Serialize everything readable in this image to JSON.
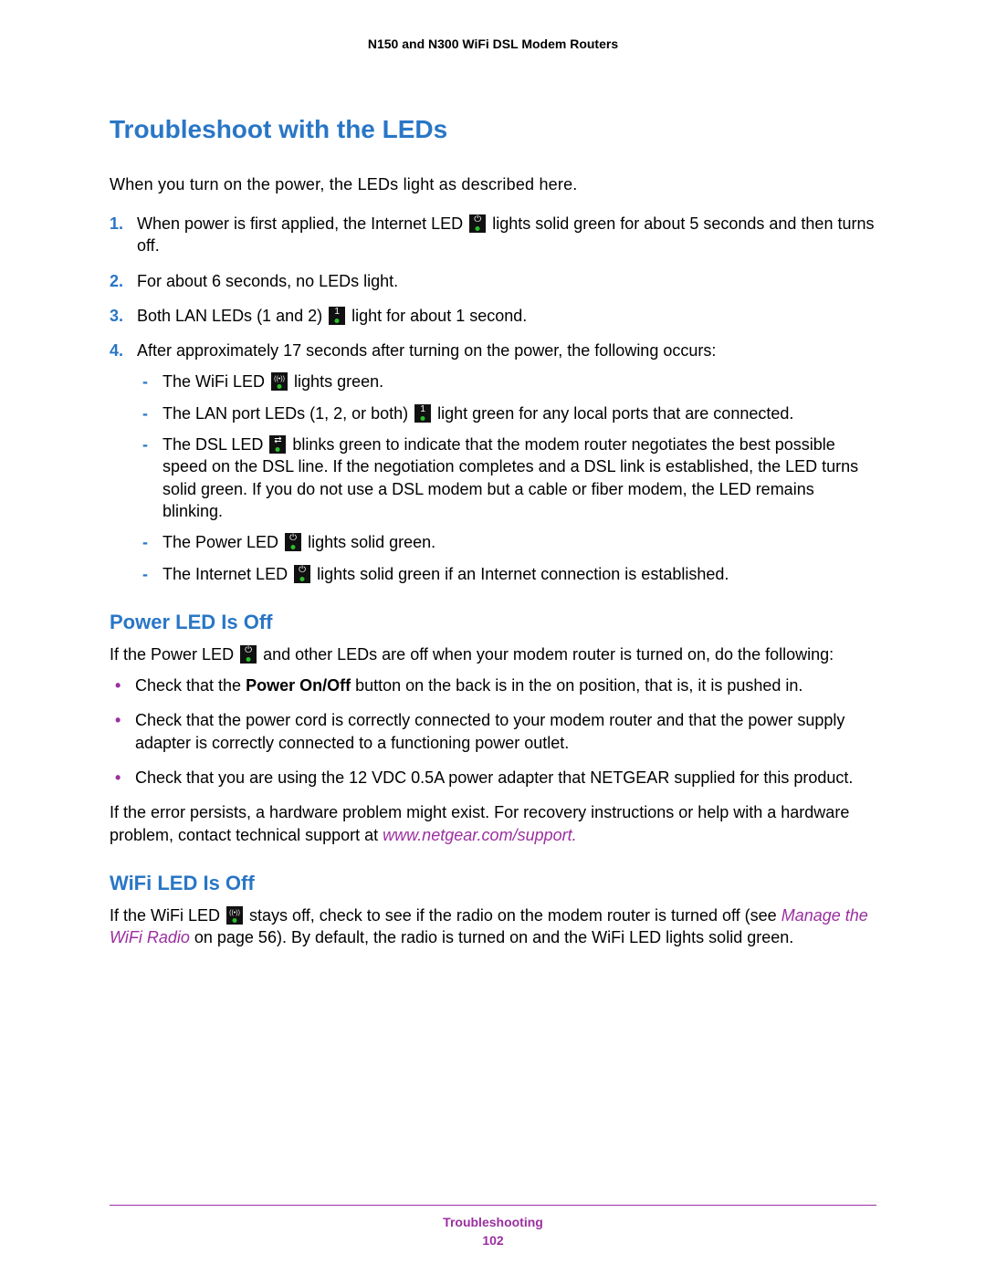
{
  "header_title": "N150 and N300 WiFi DSL Modem Routers",
  "main_title": "Troubleshoot with the LEDs",
  "intro": "When you turn on the power, the LEDs light as described here.",
  "list": {
    "item1_pre": "When power is first applied, the Internet LED ",
    "item1_post": " lights solid green for about 5 seconds and then turns off.",
    "item2": "For about 6 seconds, no LEDs light.",
    "item3_pre": "Both LAN LEDs (1 and 2) ",
    "item3_post": " light for about 1 second.",
    "item4": "After approximately 17 seconds after turning on the power, the following occurs:",
    "dash": {
      "d1_pre": "The WiFi LED ",
      "d1_post": " lights green.",
      "d2_pre": "The LAN port LEDs (1, 2, or both) ",
      "d2_post": " light green for any local ports that are connected.",
      "d3_pre": "The DSL LED ",
      "d3_post": " blinks green to indicate that the modem router negotiates the best possible speed on the DSL line. If the negotiation completes and a DSL link is established, the LED turns solid green. If you do not use a DSL modem but a cable or fiber modem, the LED remains blinking.",
      "d4_pre": "The Power LED ",
      "d4_post": " lights solid green.",
      "d5_pre": "The Internet LED ",
      "d5_post": " lights solid green if an Internet connection is established."
    }
  },
  "power_section": {
    "title": "Power LED Is Off",
    "intro_pre": "If the Power LED ",
    "intro_post": " and other LEDs are off when your modem router is turned on, do the following:",
    "b1_pre": "Check that the ",
    "b1_bold": "Power On/Off",
    "b1_post": " button on the back is in the on position, that is, it is pushed in.",
    "b2": "Check that the power cord is correctly connected to your modem router and that the power supply adapter is correctly connected to a functioning power outlet.",
    "b3": "Check that you are using the 12 VDC 0.5A power adapter that NETGEAR supplied for this product.",
    "outro_pre": "If the error persists, a hardware problem might exist. For recovery instructions or help with a hardware problem, contact technical support at ",
    "outro_link": "www.netgear.com/support.",
    "outro_post": ""
  },
  "wifi_section": {
    "title": "WiFi LED Is Off",
    "p_pre": "If the WiFi LED ",
    "p_mid": " stays off, check to see if the radio on the modem router is turned off (see ",
    "p_link": "Manage the WiFi Radio",
    "p_post": " on page 56). By default, the radio is turned on and the WiFi LED lights solid green."
  },
  "footer": {
    "section": "Troubleshooting",
    "page": "102"
  },
  "icons": {
    "internet": "⏻",
    "lan": "1",
    "wifi": "((•))",
    "dsl": "⇄",
    "power": "⏻"
  }
}
